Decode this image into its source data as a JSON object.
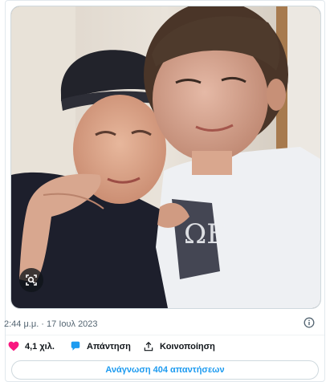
{
  "tweet": {
    "timestamp": "2:44 μ.μ. · 17 Ιουλ 2023",
    "image_alt": "Photo of two people hugging"
  },
  "actions": {
    "like_count": "4,1 χιλ.",
    "reply_label": "Απάντηση",
    "share_label": "Κοινοποίηση"
  },
  "read_replies_label": "Ανάγνωση 404 απαντήσεων",
  "colors": {
    "like": "#f91880",
    "reply": "#1d9bf0",
    "link": "#1d9bf0",
    "muted": "#536471"
  }
}
